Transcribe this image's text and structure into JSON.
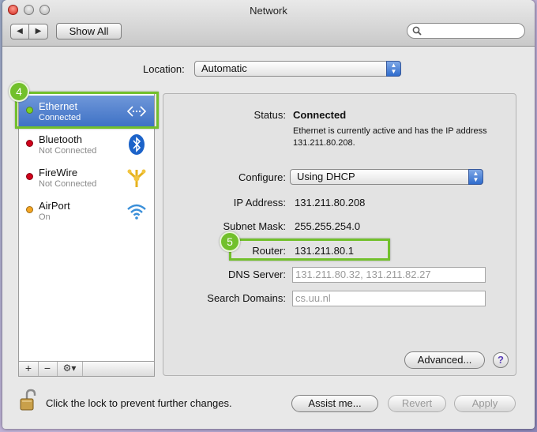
{
  "window": {
    "title": "Network",
    "back_label": "◀",
    "forward_label": "▶",
    "show_all_label": "Show All",
    "search_placeholder": ""
  },
  "location": {
    "label": "Location:",
    "value": "Automatic"
  },
  "services": [
    {
      "name": "Ethernet",
      "state": "Connected",
      "status_color": "#7ed321",
      "icon": "ethernet-arrows-icon",
      "selected": true
    },
    {
      "name": "Bluetooth",
      "state": "Not Connected",
      "status_color": "#d0021b",
      "icon": "bluetooth-icon",
      "selected": false
    },
    {
      "name": "FireWire",
      "state": "Not Connected",
      "status_color": "#d0021b",
      "icon": "firewire-icon",
      "selected": false
    },
    {
      "name": "AirPort",
      "state": "On",
      "status_color": "#f5a623",
      "icon": "wifi-icon",
      "selected": false
    }
  ],
  "sidebar_tools": {
    "add": "+",
    "remove": "−",
    "action": "⚙▾"
  },
  "detail": {
    "status_label": "Status:",
    "status_value": "Connected",
    "status_description": "Ethernet is currently active and has the IP address 131.211.80.208.",
    "configure_label": "Configure:",
    "configure_value": "Using DHCP",
    "ip_label": "IP Address:",
    "ip_value": "131.211.80.208",
    "subnet_label": "Subnet Mask:",
    "subnet_value": "255.255.254.0",
    "router_label": "Router:",
    "router_value": "131.211.80.1",
    "dns_label": "DNS Server:",
    "dns_value": "131.211.80.32, 131.211.82.27",
    "search_domains_label": "Search Domains:",
    "search_domains_value": "cs.uu.nl",
    "advanced_label": "Advanced...",
    "help_label": "?"
  },
  "footer": {
    "lock_text": "Click the lock to prevent further changes.",
    "assist_label": "Assist me...",
    "revert_label": "Revert",
    "apply_label": "Apply"
  },
  "callouts": {
    "ethernet_number": "4",
    "router_number": "5",
    "color": "#72c02c"
  }
}
